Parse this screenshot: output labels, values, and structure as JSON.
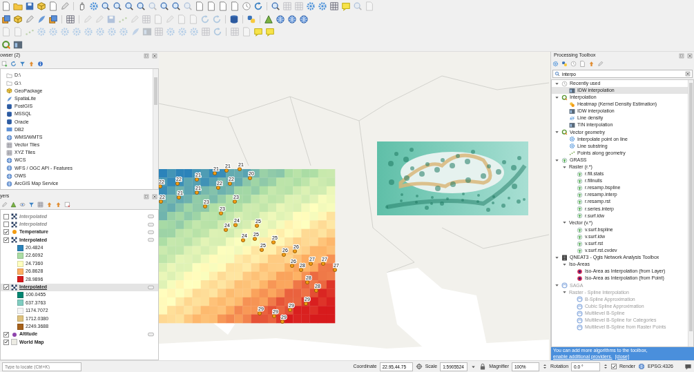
{
  "browser_panel": {
    "title": "owser (2)",
    "items": [
      {
        "label": "D:\\",
        "kind": "folder"
      },
      {
        "label": "G:\\",
        "kind": "folder"
      },
      {
        "label": "GeoPackage",
        "kind": "package"
      },
      {
        "label": "SpatiaLite",
        "kind": "feather"
      },
      {
        "label": "PostGIS",
        "kind": "database"
      },
      {
        "label": "MSSQL",
        "kind": "database"
      },
      {
        "label": "Oracle",
        "kind": "database"
      },
      {
        "label": "DB2",
        "kind": "tile"
      },
      {
        "label": "WMS/WMTS",
        "kind": "globe"
      },
      {
        "label": "Vector Tiles",
        "kind": "grid"
      },
      {
        "label": "XYZ Tiles",
        "kind": "grid"
      },
      {
        "label": "WCS",
        "kind": "globe"
      },
      {
        "label": "WFS / OGC API - Features",
        "kind": "globe"
      },
      {
        "label": "OWS",
        "kind": "globe"
      },
      {
        "label": "ArcGIS Map Service",
        "kind": "globe"
      }
    ]
  },
  "layers_panel": {
    "title": "yers",
    "layers": [
      {
        "name": "Interpolated",
        "kind": "raster",
        "checked": false,
        "selected": false,
        "indicator": true
      },
      {
        "name": "Interpolated",
        "kind": "raster",
        "checked": false,
        "selected": false,
        "indicator": true
      },
      {
        "name": "Temperature",
        "kind": "point",
        "color": "#f39c12",
        "checked": true,
        "selected": false,
        "indicator": true
      },
      {
        "name": "Interpolated",
        "kind": "raster",
        "checked": true,
        "selected": false,
        "indicator": true,
        "legend": [
          {
            "color": "#2b83ba",
            "label": "20.4824"
          },
          {
            "color": "#abdda4",
            "label": "22.6092"
          },
          {
            "color": "#ffffbf",
            "label": "24.7360"
          },
          {
            "color": "#fdae61",
            "label": "26.8628"
          },
          {
            "color": "#d7191c",
            "label": "28.9896"
          }
        ]
      },
      {
        "name": "Interpolated",
        "kind": "raster",
        "checked": true,
        "selected": true,
        "indicator": true,
        "legend": [
          {
            "color": "#018571",
            "label": "100.0455"
          },
          {
            "color": "#80cdc1",
            "label": "637.3763"
          },
          {
            "color": "#f5f5f5",
            "label": "1174.7072"
          },
          {
            "color": "#dfc27d",
            "label": "1712.0380"
          },
          {
            "color": "#a6611a",
            "label": "2249.3688"
          }
        ]
      },
      {
        "name": "Altitude",
        "kind": "point",
        "color": "#8e44ad",
        "checked": true,
        "selected": false,
        "indicator": true
      },
      {
        "name": "World Map",
        "kind": "polygon",
        "color": "#ecebe3",
        "checked": true,
        "selected": false,
        "indicator": false
      }
    ]
  },
  "map": {
    "point_labels": [
      "22",
      "22",
      "21",
      "21",
      "21",
      "21",
      "20",
      "21",
      "21",
      "22",
      "22",
      "22",
      "23",
      "23",
      "23",
      "24",
      "24",
      "25",
      "24",
      "25",
      "25",
      "25",
      "26",
      "26",
      "26",
      "27",
      "27",
      "27",
      "28",
      "28",
      "28",
      "29",
      "29",
      "29",
      "29",
      "29"
    ]
  },
  "toolbox": {
    "title": "Processing Toolbox",
    "search": {
      "value": "interpo"
    },
    "tree": [
      {
        "label": "Recently used",
        "kind": "clock",
        "expanded": true,
        "children": [
          {
            "label": "IDW interpolation",
            "kind": "tool",
            "selected": true
          }
        ]
      },
      {
        "label": "Interpolation",
        "kind": "qgis",
        "expanded": true,
        "children": [
          {
            "label": "Heatmap (Kernel Density Estimation)",
            "kind": "heatmap",
            "selected": false
          },
          {
            "label": "IDW interpolation",
            "kind": "tool",
            "selected": false
          },
          {
            "label": "Line density",
            "kind": "linedensity",
            "selected": false
          },
          {
            "label": "TIN interpolation",
            "kind": "tool",
            "selected": false
          }
        ]
      },
      {
        "label": "Vector geometry",
        "kind": "qgis",
        "expanded": true,
        "children": [
          {
            "label": "Interpolate point on line",
            "kind": "gear",
            "selected": false
          },
          {
            "label": "Line substring",
            "kind": "gear",
            "selected": false
          },
          {
            "label": "Points along geometry",
            "kind": "points",
            "selected": false
          }
        ]
      },
      {
        "label": "GRASS",
        "kind": "grass",
        "expanded": true,
        "children": [
          {
            "label": "Raster (r.*)",
            "kind": "folder",
            "expanded": true,
            "children": [
              {
                "label": "r.fill.stats",
                "kind": "grass",
                "selected": false
              },
              {
                "label": "r.fillnulls",
                "kind": "grass",
                "selected": false
              },
              {
                "label": "r.resamp.bspline",
                "kind": "grass",
                "selected": false
              },
              {
                "label": "r.resamp.interp",
                "kind": "grass",
                "selected": false
              },
              {
                "label": "r.resamp.rst",
                "kind": "grass",
                "selected": false
              },
              {
                "label": "r.series.interp",
                "kind": "grass",
                "selected": false
              },
              {
                "label": "r.surf.idw",
                "kind": "grass",
                "selected": false
              }
            ]
          },
          {
            "label": "Vector (v.*)",
            "kind": "folder",
            "expanded": true,
            "children": [
              {
                "label": "v.surf.bspline",
                "kind": "grass",
                "selected": false
              },
              {
                "label": "v.surf.idw",
                "kind": "grass",
                "selected": false
              },
              {
                "label": "v.surf.rst",
                "kind": "grass",
                "selected": false
              },
              {
                "label": "v.surf.rst.cvdev",
                "kind": "grass",
                "selected": false
              }
            ]
          }
        ]
      },
      {
        "label": "QNEAT3 - Qgis Network Analysis Toolbox",
        "kind": "qneat",
        "expanded": true,
        "children": [
          {
            "label": "Iso-Areas",
            "kind": "folder",
            "expanded": true,
            "children": [
              {
                "label": "Iso-Area as Interpolation (from Layer)",
                "kind": "iso",
                "selected": false
              },
              {
                "label": "Iso-Area as Interpolation (from Point)",
                "kind": "iso",
                "selected": false
              }
            ]
          }
        ]
      },
      {
        "label": "SAGA",
        "kind": "saga",
        "expanded": true,
        "disabled": true,
        "children": [
          {
            "label": "Raster - Spline Interpolation",
            "kind": "folder",
            "expanded": true,
            "children": [
              {
                "label": "B-Spline Approximation",
                "kind": "saga",
                "selected": false
              },
              {
                "label": "Cubic Spline Approximation",
                "kind": "saga",
                "selected": false
              },
              {
                "label": "Multilevel B-Spline",
                "kind": "saga",
                "selected": false
              },
              {
                "label": "Multilevel B-Spline for Categories",
                "kind": "saga",
                "selected": false
              },
              {
                "label": "Multilevel B-Spline from Raster Points",
                "kind": "saga",
                "selected": false
              }
            ]
          }
        ]
      }
    ],
    "banner": {
      "text": "You can add more algorithms to the toolbox,",
      "link": "enable additional providers.",
      "close": "[close]"
    }
  },
  "status_bar": {
    "locate_placeholder": "Type to locate (Ctrl+K)",
    "coordinate_label": "Coordinate",
    "coordinate": "22.95,44.75",
    "scale_label": "Scale",
    "scale": "1:5905524",
    "magnifier_label": "Magnifier",
    "magnifier": "100%",
    "rotation_label": "Rotation",
    "rotation": "0.0 °",
    "render": {
      "label": "Render",
      "checked": true
    },
    "crs": "EPSG:4326"
  }
}
